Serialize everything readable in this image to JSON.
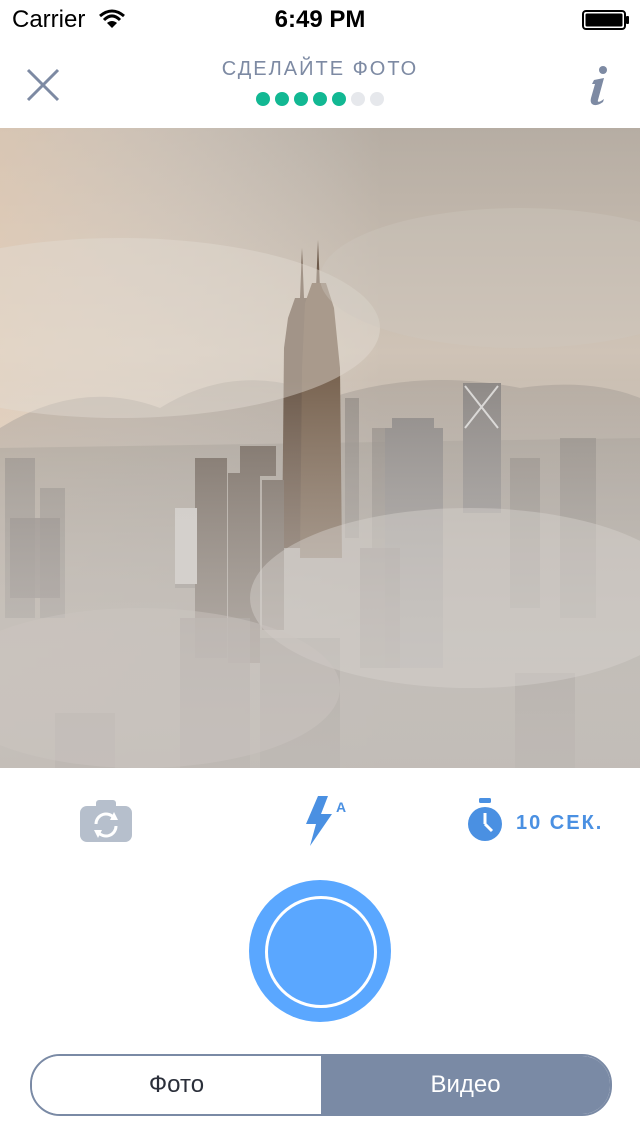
{
  "status": {
    "carrier": "Carrier",
    "time": "6:49 PM"
  },
  "nav": {
    "title": "СДЕЛАЙТЕ ФОТО",
    "progress": {
      "total": 7,
      "completed": 5
    },
    "colors": {
      "dot_on": "#12b893",
      "dot_off": "#e6e8ec",
      "title": "#7d8aa3"
    }
  },
  "controls": {
    "timer_label": "10 СЕК.",
    "flash_mode": "A",
    "icons": [
      "switch-camera-icon",
      "flash-auto-icon",
      "timer-icon"
    ],
    "accent": "#4a90e2"
  },
  "shutter": {
    "color": "#5aa7ff"
  },
  "mode": {
    "options": [
      "Фото",
      "Видео"
    ],
    "selected": "Видео",
    "color": "#7a8aa5"
  }
}
